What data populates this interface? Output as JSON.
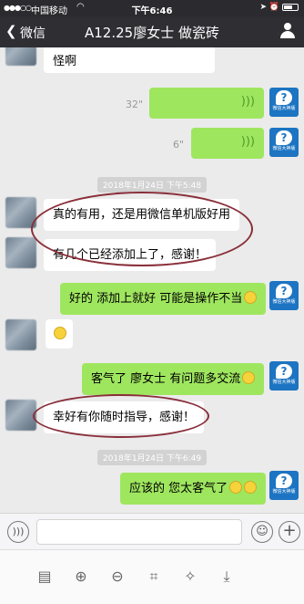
{
  "status_bar": {
    "signal": "●●●○○",
    "carrier": "中国移动",
    "time": "下午6:46",
    "wifi_icon": "wifi-icon",
    "battery_icon": "battery-icon"
  },
  "nav": {
    "back_label": "微信",
    "title": "A12.25廖女士 做瓷砖"
  },
  "messages": {
    "top_partial": "怪啊",
    "voice1_duration": "32\"",
    "voice2_duration": "6\"",
    "timestamp1": "2018年1月24日 下午5:48",
    "in1": "真的有用，还是用微信单机版好用",
    "in2": "有几个已经添加上了，感谢！",
    "out1": "好的 添加上就好 可能是操作不当",
    "out2": "客气了 廖女士 有问题多交流",
    "in3": "幸好有你随时指导，感谢！",
    "timestamp2": "2018年1月24日 下午6:49",
    "out3": "应该的 您太客气了",
    "sys_avatar_caption": "微信大神版"
  },
  "colors": {
    "green_bubble": "#9fe65f",
    "navbar": "#2e2e33",
    "highlight_circle": "#8a2f3a"
  },
  "icons": {
    "back": "chevron-left-icon",
    "profile": "person-icon",
    "voice": "voice-icon",
    "emoji": "emoji-icon",
    "plus": "plus-icon",
    "layout": "layout-icon",
    "zoom_in": "zoom-in-icon",
    "zoom_out": "zoom-out-icon",
    "crop": "crop-icon",
    "magic": "magic-wand-icon",
    "download": "download-icon"
  }
}
